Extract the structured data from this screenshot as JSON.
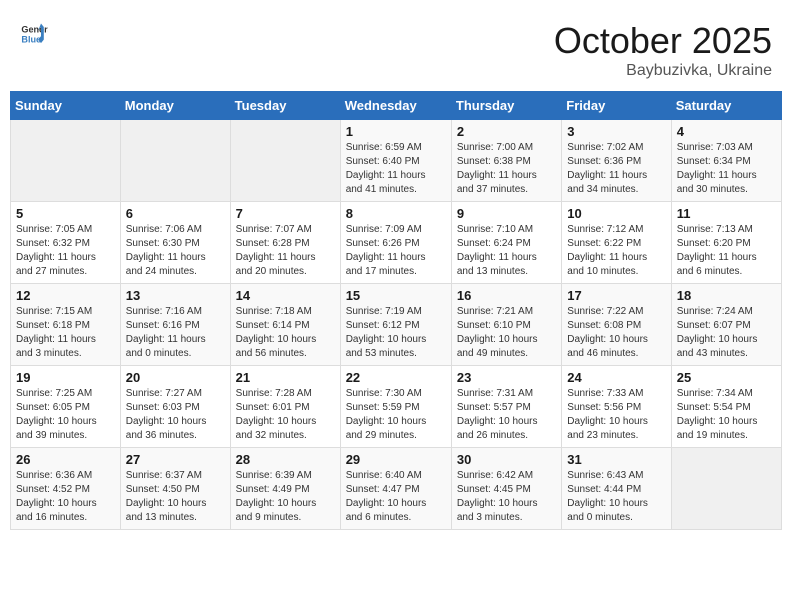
{
  "header": {
    "logo_line1": "General",
    "logo_line2": "Blue",
    "month": "October 2025",
    "location": "Baybuzivka, Ukraine"
  },
  "weekdays": [
    "Sunday",
    "Monday",
    "Tuesday",
    "Wednesday",
    "Thursday",
    "Friday",
    "Saturday"
  ],
  "weeks": [
    [
      {
        "day": "",
        "info": ""
      },
      {
        "day": "",
        "info": ""
      },
      {
        "day": "",
        "info": ""
      },
      {
        "day": "1",
        "info": "Sunrise: 6:59 AM\nSunset: 6:40 PM\nDaylight: 11 hours\nand 41 minutes."
      },
      {
        "day": "2",
        "info": "Sunrise: 7:00 AM\nSunset: 6:38 PM\nDaylight: 11 hours\nand 37 minutes."
      },
      {
        "day": "3",
        "info": "Sunrise: 7:02 AM\nSunset: 6:36 PM\nDaylight: 11 hours\nand 34 minutes."
      },
      {
        "day": "4",
        "info": "Sunrise: 7:03 AM\nSunset: 6:34 PM\nDaylight: 11 hours\nand 30 minutes."
      }
    ],
    [
      {
        "day": "5",
        "info": "Sunrise: 7:05 AM\nSunset: 6:32 PM\nDaylight: 11 hours\nand 27 minutes."
      },
      {
        "day": "6",
        "info": "Sunrise: 7:06 AM\nSunset: 6:30 PM\nDaylight: 11 hours\nand 24 minutes."
      },
      {
        "day": "7",
        "info": "Sunrise: 7:07 AM\nSunset: 6:28 PM\nDaylight: 11 hours\nand 20 minutes."
      },
      {
        "day": "8",
        "info": "Sunrise: 7:09 AM\nSunset: 6:26 PM\nDaylight: 11 hours\nand 17 minutes."
      },
      {
        "day": "9",
        "info": "Sunrise: 7:10 AM\nSunset: 6:24 PM\nDaylight: 11 hours\nand 13 minutes."
      },
      {
        "day": "10",
        "info": "Sunrise: 7:12 AM\nSunset: 6:22 PM\nDaylight: 11 hours\nand 10 minutes."
      },
      {
        "day": "11",
        "info": "Sunrise: 7:13 AM\nSunset: 6:20 PM\nDaylight: 11 hours\nand 6 minutes."
      }
    ],
    [
      {
        "day": "12",
        "info": "Sunrise: 7:15 AM\nSunset: 6:18 PM\nDaylight: 11 hours\nand 3 minutes."
      },
      {
        "day": "13",
        "info": "Sunrise: 7:16 AM\nSunset: 6:16 PM\nDaylight: 11 hours\nand 0 minutes."
      },
      {
        "day": "14",
        "info": "Sunrise: 7:18 AM\nSunset: 6:14 PM\nDaylight: 10 hours\nand 56 minutes."
      },
      {
        "day": "15",
        "info": "Sunrise: 7:19 AM\nSunset: 6:12 PM\nDaylight: 10 hours\nand 53 minutes."
      },
      {
        "day": "16",
        "info": "Sunrise: 7:21 AM\nSunset: 6:10 PM\nDaylight: 10 hours\nand 49 minutes."
      },
      {
        "day": "17",
        "info": "Sunrise: 7:22 AM\nSunset: 6:08 PM\nDaylight: 10 hours\nand 46 minutes."
      },
      {
        "day": "18",
        "info": "Sunrise: 7:24 AM\nSunset: 6:07 PM\nDaylight: 10 hours\nand 43 minutes."
      }
    ],
    [
      {
        "day": "19",
        "info": "Sunrise: 7:25 AM\nSunset: 6:05 PM\nDaylight: 10 hours\nand 39 minutes."
      },
      {
        "day": "20",
        "info": "Sunrise: 7:27 AM\nSunset: 6:03 PM\nDaylight: 10 hours\nand 36 minutes."
      },
      {
        "day": "21",
        "info": "Sunrise: 7:28 AM\nSunset: 6:01 PM\nDaylight: 10 hours\nand 32 minutes."
      },
      {
        "day": "22",
        "info": "Sunrise: 7:30 AM\nSunset: 5:59 PM\nDaylight: 10 hours\nand 29 minutes."
      },
      {
        "day": "23",
        "info": "Sunrise: 7:31 AM\nSunset: 5:57 PM\nDaylight: 10 hours\nand 26 minutes."
      },
      {
        "day": "24",
        "info": "Sunrise: 7:33 AM\nSunset: 5:56 PM\nDaylight: 10 hours\nand 23 minutes."
      },
      {
        "day": "25",
        "info": "Sunrise: 7:34 AM\nSunset: 5:54 PM\nDaylight: 10 hours\nand 19 minutes."
      }
    ],
    [
      {
        "day": "26",
        "info": "Sunrise: 6:36 AM\nSunset: 4:52 PM\nDaylight: 10 hours\nand 16 minutes."
      },
      {
        "day": "27",
        "info": "Sunrise: 6:37 AM\nSunset: 4:50 PM\nDaylight: 10 hours\nand 13 minutes."
      },
      {
        "day": "28",
        "info": "Sunrise: 6:39 AM\nSunset: 4:49 PM\nDaylight: 10 hours\nand 9 minutes."
      },
      {
        "day": "29",
        "info": "Sunrise: 6:40 AM\nSunset: 4:47 PM\nDaylight: 10 hours\nand 6 minutes."
      },
      {
        "day": "30",
        "info": "Sunrise: 6:42 AM\nSunset: 4:45 PM\nDaylight: 10 hours\nand 3 minutes."
      },
      {
        "day": "31",
        "info": "Sunrise: 6:43 AM\nSunset: 4:44 PM\nDaylight: 10 hours\nand 0 minutes."
      },
      {
        "day": "",
        "info": ""
      }
    ]
  ]
}
